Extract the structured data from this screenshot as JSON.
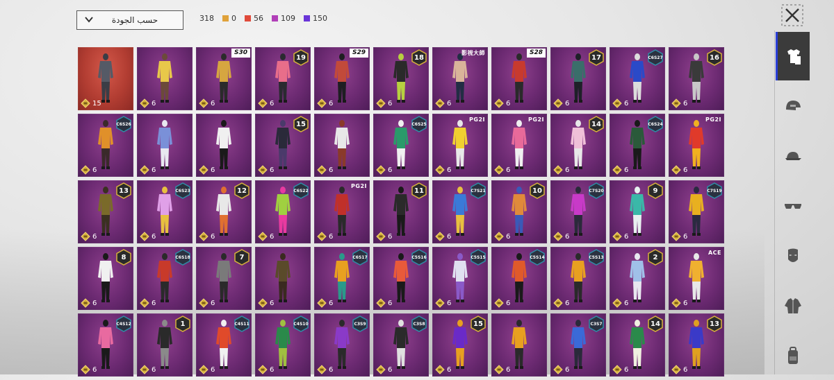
{
  "sort": {
    "label": "حسب الجودة"
  },
  "stats": {
    "total": "318",
    "items": [
      {
        "value": "0",
        "color": "#e0a23a"
      },
      {
        "value": "56",
        "color": "#e04a3a"
      },
      {
        "value": "109",
        "color": "#b13fb8"
      },
      {
        "value": "150",
        "color": "#6a35d8"
      }
    ]
  },
  "colors": {
    "accent": "#2a3fd6",
    "card_purple": "#6c2a72",
    "card_red": "#b23d32",
    "badge_gold": "#d7b13c",
    "badge_teal": "#2f6f86"
  },
  "sidebar": {
    "items": [
      {
        "icon": "outfit-icon",
        "active": true
      },
      {
        "icon": "helmet-icon",
        "active": false
      },
      {
        "icon": "cap-icon",
        "active": false
      },
      {
        "icon": "glasses-icon",
        "active": false
      },
      {
        "icon": "mask-icon",
        "active": false
      },
      {
        "icon": "jacket-icon",
        "active": false
      },
      {
        "icon": "backpack-icon",
        "active": false
      }
    ]
  },
  "cards": [
    {
      "qty": "15",
      "badge": null,
      "bg": "red",
      "palette": [
        "#555a66",
        "#3a3d46"
      ]
    },
    {
      "qty": "6",
      "badge": null,
      "palette": [
        "#e8c84a",
        "#6b4a3a"
      ]
    },
    {
      "qty": "6",
      "badge": {
        "type": "season",
        "text": "S30"
      },
      "palette": [
        "#d6a640",
        "#2b2b2b"
      ]
    },
    {
      "qty": "6",
      "badge": {
        "type": "num",
        "text": "19"
      },
      "palette": [
        "#e86e8a",
        "#2a2a30"
      ]
    },
    {
      "qty": "6",
      "badge": {
        "type": "season",
        "text": "S29"
      },
      "palette": [
        "#c24a3a",
        "#1e1e22"
      ]
    },
    {
      "qty": "6",
      "badge": {
        "type": "num",
        "text": "18"
      },
      "palette": [
        "#2a2a2a",
        "#b7d040"
      ]
    },
    {
      "qty": "6",
      "badge": {
        "type": "brand",
        "text": "影視大師"
      },
      "palette": [
        "#d9b49a",
        "#222d44"
      ]
    },
    {
      "qty": "6",
      "badge": {
        "type": "season",
        "text": "S28"
      },
      "palette": [
        "#c83a2e",
        "#2a2a2a"
      ]
    },
    {
      "qty": "6",
      "badge": {
        "type": "num",
        "text": "17"
      },
      "palette": [
        "#3a6e6a",
        "#1e2028"
      ]
    },
    {
      "qty": "6",
      "badge": {
        "type": "hex",
        "text": "C6S27"
      },
      "palette": [
        "#2a4ac8",
        "#dcdcdc"
      ]
    },
    {
      "qty": "6",
      "badge": {
        "type": "num",
        "text": "16"
      },
      "palette": [
        "#3a3a3a",
        "#c8c8c8"
      ]
    },
    {
      "qty": "6",
      "badge": {
        "type": "hex",
        "text": "C6S26"
      },
      "palette": [
        "#e0902a",
        "#3a2a2a"
      ]
    },
    {
      "qty": "6",
      "badge": null,
      "palette": [
        "#7a90d8",
        "#e8e8f0"
      ]
    },
    {
      "qty": "6",
      "badge": null,
      "palette": [
        "#f0f0f0",
        "#1a1a1a"
      ]
    },
    {
      "qty": "6",
      "badge": {
        "type": "num",
        "text": "15"
      },
      "palette": [
        "#2a2a3a",
        "#4a3a6a"
      ]
    },
    {
      "qty": "6",
      "badge": null,
      "palette": [
        "#e8e8e8",
        "#8a3a2a"
      ]
    },
    {
      "qty": "6",
      "badge": {
        "type": "hex",
        "text": "C6S25"
      },
      "palette": [
        "#2a9a6a",
        "#f0f0f0"
      ]
    },
    {
      "qty": "6",
      "badge": {
        "type": "brand",
        "text": "PG2I"
      },
      "palette": [
        "#f0d030",
        "#e8e8e8"
      ]
    },
    {
      "qty": "6",
      "badge": {
        "type": "brand",
        "text": "PG2I"
      },
      "palette": [
        "#e86a9a",
        "#f0f0f0"
      ]
    },
    {
      "qty": "6",
      "badge": {
        "type": "num",
        "text": "14"
      },
      "palette": [
        "#f0c0d8",
        "#e8e8e8"
      ]
    },
    {
      "qty": "6",
      "badge": {
        "type": "hex",
        "text": "C6S24"
      },
      "palette": [
        "#2a5a3a",
        "#1a1a1a"
      ]
    },
    {
      "qty": "6",
      "badge": {
        "type": "brand",
        "text": "PG2I"
      },
      "palette": [
        "#e03a2a",
        "#f0b020"
      ]
    },
    {
      "qty": "6",
      "badge": {
        "type": "num",
        "text": "13"
      },
      "palette": [
        "#7a6a2a",
        "#3a3020"
      ]
    },
    {
      "qty": "6",
      "badge": {
        "type": "hex",
        "text": "C6S23"
      },
      "palette": [
        "#e0a0e8",
        "#e8c040"
      ]
    },
    {
      "qty": "6",
      "badge": {
        "type": "num",
        "text": "12"
      },
      "palette": [
        "#e8e8e8",
        "#e07030"
      ]
    },
    {
      "qty": "6",
      "badge": {
        "type": "hex",
        "text": "C6S22"
      },
      "palette": [
        "#a0d040",
        "#e83aa0"
      ]
    },
    {
      "qty": "6",
      "badge": {
        "type": "brand",
        "text": "PG2I"
      },
      "palette": [
        "#c0302a",
        "#2a2a2a"
      ]
    },
    {
      "qty": "6",
      "badge": {
        "type": "num",
        "text": "11"
      },
      "palette": [
        "#2a2a2a",
        "#1a1a1a"
      ]
    },
    {
      "qty": "6",
      "badge": {
        "type": "hex",
        "text": "C7S21"
      },
      "palette": [
        "#3a7ad8",
        "#e8c040"
      ]
    },
    {
      "qty": "6",
      "badge": {
        "type": "num",
        "text": "10"
      },
      "palette": [
        "#e08a3a",
        "#3a5ab8"
      ]
    },
    {
      "qty": "6",
      "badge": {
        "type": "hex",
        "text": "C7S20"
      },
      "palette": [
        "#c83ac8",
        "#2a2a3a"
      ]
    },
    {
      "qty": "6",
      "badge": {
        "type": "num",
        "text": "9"
      },
      "palette": [
        "#3ab8a8",
        "#e8f0f0"
      ]
    },
    {
      "qty": "6",
      "badge": {
        "type": "hex",
        "text": "C7S19"
      },
      "palette": [
        "#e8b020",
        "#2a2a40"
      ]
    },
    {
      "qty": "6",
      "badge": {
        "type": "num",
        "text": "8"
      },
      "palette": [
        "#f0f0f0",
        "#1a1a1a"
      ]
    },
    {
      "qty": "6",
      "badge": {
        "type": "hex",
        "text": "C6S18"
      },
      "palette": [
        "#c83a2a",
        "#2a2a2a"
      ]
    },
    {
      "qty": "6",
      "badge": {
        "type": "num",
        "text": "7"
      },
      "palette": [
        "#7a7a7a",
        "#2a2a2a"
      ]
    },
    {
      "qty": "6",
      "badge": null,
      "palette": [
        "#5a4a2a",
        "#3a2a20"
      ]
    },
    {
      "qty": "6",
      "badge": {
        "type": "hex",
        "text": "C6S17"
      },
      "palette": [
        "#e8a020",
        "#2a9a8a"
      ]
    },
    {
      "qty": "6",
      "badge": {
        "type": "hex",
        "text": "C5S16"
      },
      "palette": [
        "#e85a3a",
        "#1a1a1a"
      ]
    },
    {
      "qty": "6",
      "badge": {
        "type": "hex",
        "text": "C5S15"
      },
      "palette": [
        "#e0e0f0",
        "#8a5ac8"
      ]
    },
    {
      "qty": "6",
      "badge": {
        "type": "hex",
        "text": "C5S14"
      },
      "palette": [
        "#e05a2a",
        "#1a1a1a"
      ]
    },
    {
      "qty": "6",
      "badge": {
        "type": "hex",
        "text": "C5S13"
      },
      "palette": [
        "#e8a020",
        "#2a2a2a"
      ]
    },
    {
      "qty": "6",
      "badge": {
        "type": "num",
        "text": "2"
      },
      "palette": [
        "#a0c0e8",
        "#e8e8f0"
      ]
    },
    {
      "qty": "6",
      "badge": {
        "type": "brand",
        "text": "ACE"
      },
      "palette": [
        "#f0b030",
        "#e8e8e8"
      ]
    },
    {
      "qty": "6",
      "badge": {
        "type": "hex",
        "text": "C4S12"
      },
      "palette": [
        "#e86aa0",
        "#1a1a1a"
      ]
    },
    {
      "qty": "6",
      "badge": {
        "type": "num",
        "text": "1"
      },
      "palette": [
        "#2a2a2a",
        "#8a8a8a"
      ]
    },
    {
      "qty": "6",
      "badge": {
        "type": "hex",
        "text": "C4S11"
      },
      "palette": [
        "#e04a2a",
        "#f0f0f0"
      ]
    },
    {
      "qty": "6",
      "badge": {
        "type": "hex",
        "text": "C4S10"
      },
      "palette": [
        "#2a8a4a",
        "#a0c040"
      ]
    },
    {
      "qty": "6",
      "badge": {
        "type": "hex",
        "text": "C3S9"
      },
      "palette": [
        "#8a3ac8",
        "#2a2a2a"
      ]
    },
    {
      "qty": "6",
      "badge": {
        "type": "hex",
        "text": "C3S8"
      },
      "palette": [
        "#2a2a2a",
        "#e0e0e0"
      ]
    },
    {
      "qty": "6",
      "badge": {
        "type": "num",
        "text": "15"
      },
      "palette": [
        "#6a2ac8",
        "#e8a020"
      ]
    },
    {
      "qty": "6",
      "badge": null,
      "palette": [
        "#e8a020",
        "#2a2a2a"
      ]
    },
    {
      "qty": "6",
      "badge": {
        "type": "hex",
        "text": "C3S7"
      },
      "palette": [
        "#3a6ad8",
        "#2a2a3a"
      ]
    },
    {
      "qty": "6",
      "badge": {
        "type": "num",
        "text": "14"
      },
      "palette": [
        "#2a8a4a",
        "#f0f0e0"
      ]
    },
    {
      "qty": "6",
      "badge": {
        "type": "num",
        "text": "13"
      },
      "palette": [
        "#3a3ac8",
        "#e0a020"
      ]
    }
  ]
}
